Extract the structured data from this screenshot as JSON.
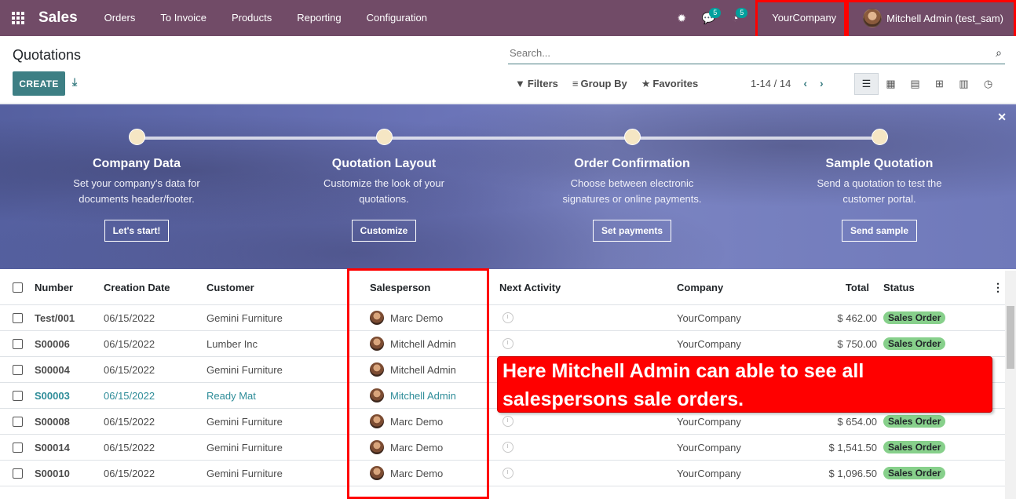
{
  "navbar": {
    "app_name": "Sales",
    "menu": [
      "Orders",
      "To Invoice",
      "Products",
      "Reporting",
      "Configuration"
    ],
    "messages_count": "5",
    "activities_count": "5",
    "company": "YourCompany",
    "user": "Mitchell Admin (test_sam)"
  },
  "control_panel": {
    "title": "Quotations",
    "create_label": "CREATE",
    "search_placeholder": "Search...",
    "filters_label": "Filters",
    "groupby_label": "Group By",
    "favorites_label": "Favorites",
    "pager": "1-14 / 14"
  },
  "banner": {
    "steps": [
      {
        "title": "Company Data",
        "desc1": "Set your company's data for",
        "desc2": "documents header/footer.",
        "button": "Let's start!"
      },
      {
        "title": "Quotation Layout",
        "desc1": "Customize the look of your",
        "desc2": "quotations.",
        "button": "Customize"
      },
      {
        "title": "Order Confirmation",
        "desc1": "Choose between electronic",
        "desc2": "signatures or online payments.",
        "button": "Set payments"
      },
      {
        "title": "Sample Quotation",
        "desc1": "Send a quotation to test the",
        "desc2": "customer portal.",
        "button": "Send sample"
      }
    ]
  },
  "table": {
    "columns": {
      "number": "Number",
      "date": "Creation Date",
      "customer": "Customer",
      "salesperson": "Salesperson",
      "activity": "Next Activity",
      "company": "Company",
      "total": "Total",
      "status": "Status"
    },
    "rows": [
      {
        "number": "Test/001",
        "date": "06/15/2022",
        "customer": "Gemini Furniture",
        "salesperson": "Marc Demo",
        "company": "YourCompany",
        "total": "$ 462.00",
        "status": "Sales Order"
      },
      {
        "number": "S00006",
        "date": "06/15/2022",
        "customer": "Lumber Inc",
        "salesperson": "Mitchell Admin",
        "company": "YourCompany",
        "total": "$ 750.00",
        "status": "Sales Order"
      },
      {
        "number": "S00004",
        "date": "06/15/2022",
        "customer": "Gemini Furniture",
        "salesperson": "Mitchell Admin",
        "company": "",
        "total": "",
        "status": ""
      },
      {
        "number": "S00003",
        "date": "06/15/2022",
        "customer": "Ready Mat",
        "salesperson": "Mitchell Admin",
        "company": "",
        "total": "",
        "status": ""
      },
      {
        "number": "S00008",
        "date": "06/15/2022",
        "customer": "Gemini Furniture",
        "salesperson": "Marc Demo",
        "company": "YourCompany",
        "total": "$ 654.00",
        "status": "Sales Order"
      },
      {
        "number": "S00014",
        "date": "06/15/2022",
        "customer": "Gemini Furniture",
        "salesperson": "Marc Demo",
        "company": "YourCompany",
        "total": "$ 1,541.50",
        "status": "Sales Order"
      },
      {
        "number": "S00010",
        "date": "06/15/2022",
        "customer": "Gemini Furniture",
        "salesperson": "Marc Demo",
        "company": "YourCompany",
        "total": "$ 1,096.50",
        "status": "Sales Order"
      }
    ]
  },
  "annotation": {
    "text": "Here Mitchell Admin can able to see all salespersons sale orders.",
    "color": "#ff0000"
  },
  "colors": {
    "brand": "#714b67",
    "primary": "#3d7f84",
    "link": "#2f8d99",
    "status_badge": "#87d08b"
  }
}
